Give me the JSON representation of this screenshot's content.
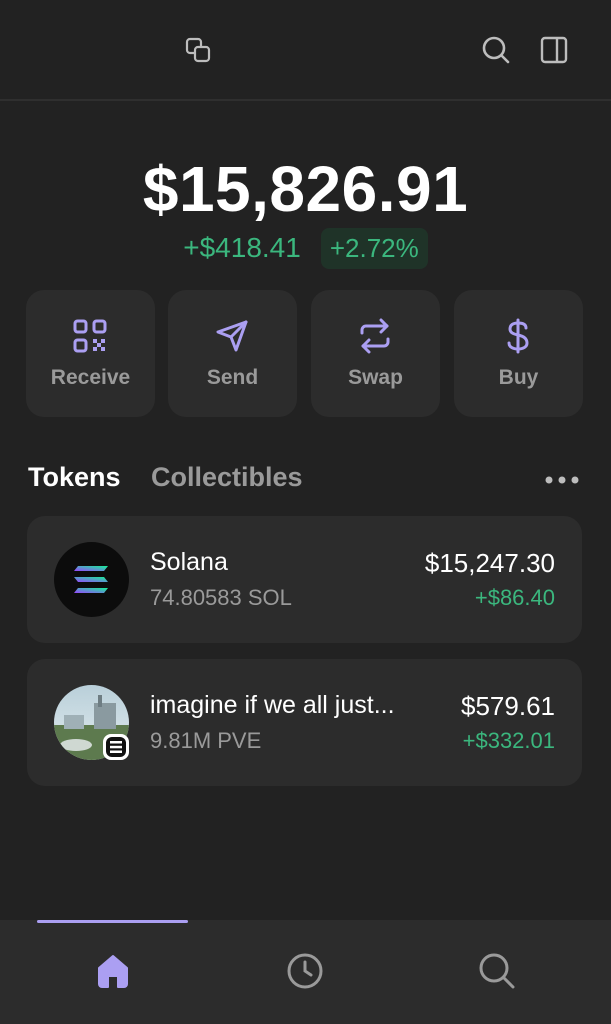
{
  "balance": {
    "total": "$15,826.91",
    "change_value": "+$418.41",
    "change_percent": "+2.72%"
  },
  "actions": [
    {
      "label": "Receive",
      "icon": "qr-code-icon"
    },
    {
      "label": "Send",
      "icon": "send-icon"
    },
    {
      "label": "Swap",
      "icon": "swap-icon"
    },
    {
      "label": "Buy",
      "icon": "dollar-icon"
    }
  ],
  "tabs": {
    "tokens": "Tokens",
    "collectibles": "Collectibles",
    "active": "Tokens"
  },
  "tokens": [
    {
      "name": "Solana",
      "amount": "74.80583 SOL",
      "value": "$15,247.30",
      "change": "+$86.40"
    },
    {
      "name": "imagine if we all just...",
      "amount": "9.81M PVE",
      "value": "$579.61",
      "change": "+$332.01"
    }
  ],
  "header_icons": [
    "copy-icon",
    "search-icon",
    "sidebar-icon"
  ],
  "bottom_nav": {
    "items": [
      "home-icon",
      "history-icon",
      "search-icon"
    ],
    "active": "home-icon"
  },
  "colors": {
    "background": "#222222",
    "card": "#2c2c2c",
    "accent": "#ab9ff2",
    "positive": "#3bb77e",
    "muted": "#9a9a9a"
  }
}
